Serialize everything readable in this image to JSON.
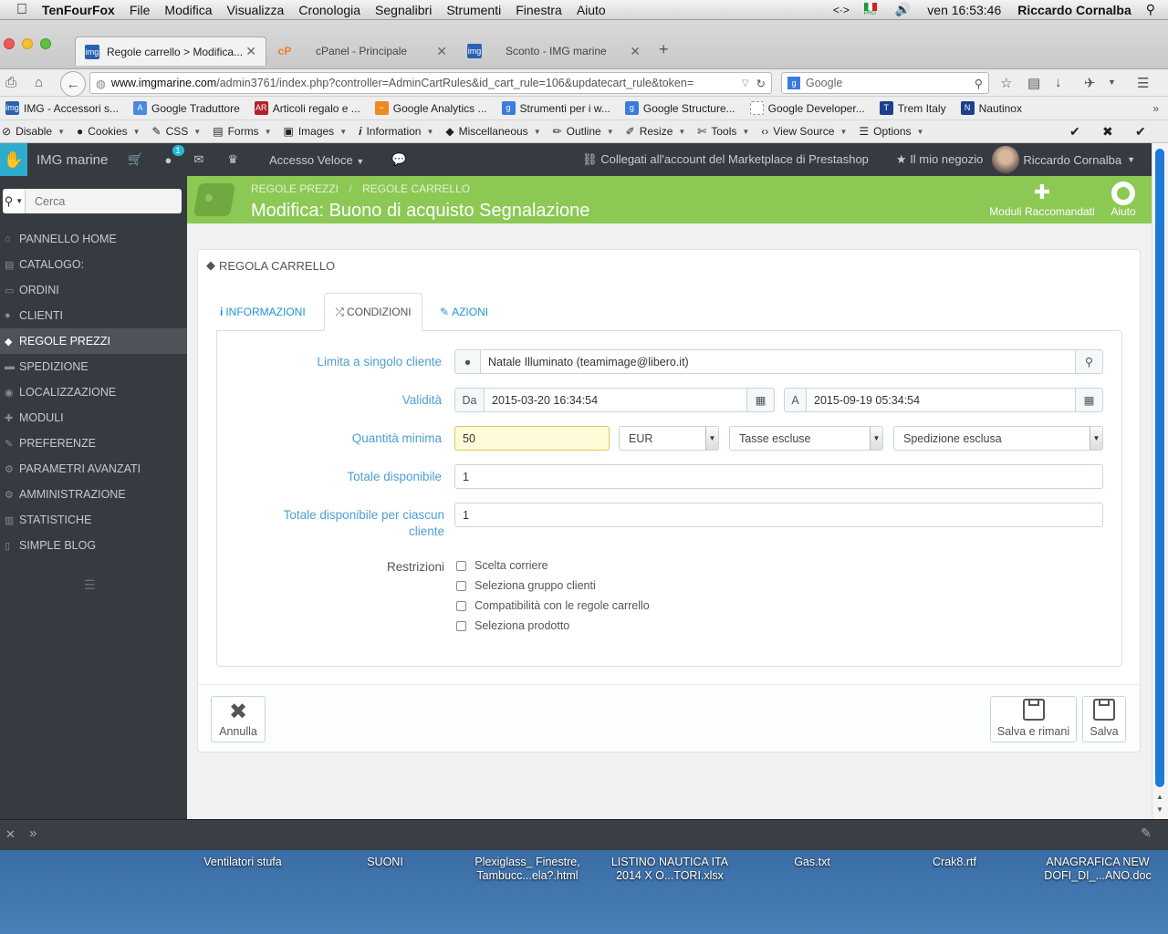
{
  "os_menubar": {
    "app": "TenFourFox",
    "menus": [
      "File",
      "Modifica",
      "Visualizza",
      "Cronologia",
      "Segnalibri",
      "Strumenti",
      "Finestra",
      "Aiuto"
    ],
    "flag_label": "PRO",
    "clock": "ven 16:53:46",
    "user": "Riccardo Cornalba"
  },
  "tabs": [
    {
      "label": "Regole carrello > Modifica...",
      "favicon": "img"
    },
    {
      "label": "cPanel - Principale",
      "favicon": "cP"
    },
    {
      "label": "Sconto - IMG marine",
      "favicon": "img"
    }
  ],
  "url": {
    "domain": "www.imgmarine.com",
    "path": "/admin3761/index.php?controller=AdminCartRules&id_cart_rule=106&updatecart_rule&token=",
    "search_placeholder": "Google"
  },
  "bookmarks": [
    {
      "label": "IMG - Accessori s...",
      "color": "#2a62b0",
      "glyph": "img"
    },
    {
      "label": "Google Traduttore",
      "color": "#4a89dc",
      "glyph": "A"
    },
    {
      "label": "Articoli regalo e ...",
      "color": "#b0222a",
      "glyph": "AR"
    },
    {
      "label": "Google Analytics ...",
      "color": "#f08a1c",
      "glyph": "~"
    },
    {
      "label": "Strumenti per i w...",
      "color": "#3b7be0",
      "glyph": "g"
    },
    {
      "label": "Google Structure...",
      "color": "#3b7be0",
      "glyph": "g"
    },
    {
      "label": "Google Developer...",
      "color": "#ffffff",
      "glyph": ""
    },
    {
      "label": "Trem Italy",
      "color": "#1d3f8e",
      "glyph": "T"
    },
    {
      "label": "Nautinox",
      "color": "#1d3f8e",
      "glyph": "N"
    }
  ],
  "devbar": [
    {
      "label": "Disable",
      "icon": "⊘"
    },
    {
      "label": "Cookies",
      "icon": "●"
    },
    {
      "label": "CSS",
      "icon": "✎"
    },
    {
      "label": "Forms",
      "icon": "▤"
    },
    {
      "label": "Images",
      "icon": "▣"
    },
    {
      "label": "Information",
      "icon": "i"
    },
    {
      "label": "Miscellaneous",
      "icon": "◆"
    },
    {
      "label": "Outline",
      "icon": "✏"
    },
    {
      "label": "Resize",
      "icon": "✐"
    },
    {
      "label": "Tools",
      "icon": "✄"
    },
    {
      "label": "View Source",
      "icon": "‹›"
    },
    {
      "label": "Options",
      "icon": "☰"
    }
  ],
  "ps_header": {
    "shop_name": "IMG marine",
    "notification_count": "1",
    "quick_access": "Accesso Veloce",
    "marketplace": "Collegati all'account del Marketplace di Prestashop",
    "my_shop": "Il mio negozio",
    "employee": "Riccardo Cornalba"
  },
  "sidebar": {
    "search_placeholder": "Cerca",
    "items": [
      {
        "label": "Pannello Home",
        "icon": "⌂"
      },
      {
        "label": "Catalogo:",
        "icon": "▤"
      },
      {
        "label": "Ordini",
        "icon": "▭"
      },
      {
        "label": "Clienti",
        "icon": "●"
      },
      {
        "label": "Regole prezzi",
        "icon": "◆"
      },
      {
        "label": "Spedizione",
        "icon": "▬"
      },
      {
        "label": "Localizzazione",
        "icon": "◉"
      },
      {
        "label": "Moduli",
        "icon": "✚"
      },
      {
        "label": "Preferenze",
        "icon": "✎"
      },
      {
        "label": "Parametri avanzati",
        "icon": "⚙"
      },
      {
        "label": "Amministrazione",
        "icon": "⚙"
      },
      {
        "label": "Statistiche",
        "icon": "▥"
      },
      {
        "label": "Simple Blog",
        "icon": "▯"
      }
    ]
  },
  "page_head": {
    "breadcrumb": [
      "REGOLE PREZZI",
      "REGOLE CARRELLO"
    ],
    "title": "Modifica: Buono di acquisto Segnalazione",
    "toolbar": [
      {
        "label": "Moduli Raccomandati"
      },
      {
        "label": "Aiuto"
      }
    ]
  },
  "panel": {
    "heading": "REGOLA CARRELLO",
    "tabs": [
      {
        "label": "INFORMAZIONI",
        "icon": "i"
      },
      {
        "label": "CONDIZIONI",
        "icon": "⤮"
      },
      {
        "label": "AZIONI",
        "icon": "✎"
      }
    ],
    "fields": {
      "customer": {
        "label": "Limita a singolo cliente",
        "value": "Natale Illuminato (teamimage@libero.it)"
      },
      "validity": {
        "label": "Validità",
        "from_label": "Da",
        "from": "2015-03-20 16:34:54",
        "to_label": "A",
        "to": "2015-09-19 05:34:54"
      },
      "min_amount": {
        "label": "Quantità minima",
        "value": "50",
        "currency": "EUR",
        "tax": "Tasse escluse",
        "shipping": "Spedizione esclusa"
      },
      "total_available": {
        "label": "Totale disponibile",
        "value": "1"
      },
      "total_per_customer": {
        "label_line1": "Totale disponibile per ciascun",
        "label_line2": "cliente",
        "value": "1"
      },
      "restrictions": {
        "label": "Restrizioni",
        "options": [
          "Scelta corriere",
          "Seleziona gruppo clienti",
          "Compatibilità con le regole carrello",
          "Seleziona prodotto"
        ]
      }
    },
    "buttons": {
      "cancel": "Annulla",
      "save_stay": "Salva e rimani",
      "save": "Salva"
    }
  },
  "desktop_files": [
    {
      "line1": "Ventilatori stufa",
      "line2": ""
    },
    {
      "line1": "SUONI",
      "line2": ""
    },
    {
      "line1": "Plexiglass_ Finestre,",
      "line2": "Tambucc...ela?.html"
    },
    {
      "line1": "LISTINO NAUTICA ITA",
      "line2": "2014 X O...TORI.xlsx"
    },
    {
      "line1": "Gas.txt",
      "line2": ""
    },
    {
      "line1": "Crak8.rtf",
      "line2": ""
    },
    {
      "line1": "ANAGRAFICA NEW",
      "line2": "DOFI_DI_...ANO.doc"
    }
  ]
}
